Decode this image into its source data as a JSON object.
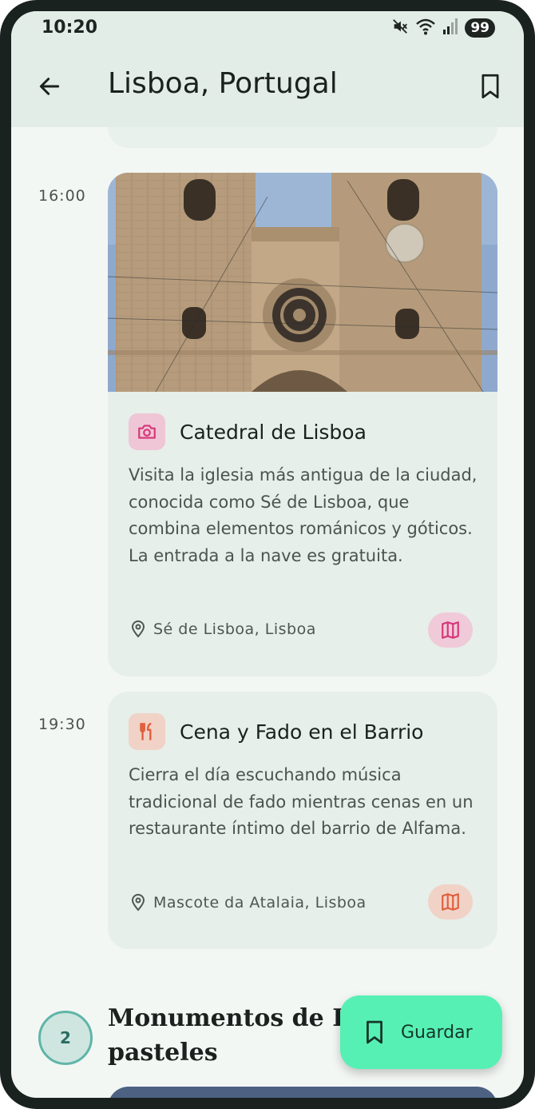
{
  "status_bar": {
    "time": "10:20",
    "battery": "99"
  },
  "app_bar": {
    "title": "Lisboa, Portugal"
  },
  "itinerary": [
    {
      "time": "16:00",
      "title": "Catedral de Lisboa",
      "category_icon": "camera-icon",
      "description": "Visita la iglesia más antigua de la ciudad, conocida como Sé de Lisboa, que combina elementos románicos y góticos. La entrada a la nave es gratuita.",
      "location": "Sé de Lisboa, Lisboa",
      "accent": "#d6367a"
    },
    {
      "time": "19:30",
      "title": "Cena y Fado en el Barrio",
      "category_icon": "restaurant-icon",
      "description": "Cierra el día escuchando música tradicional de fado mientras cenas en un restaurante íntimo del barrio de Alfama.",
      "location": "Mascote da Atalaia, Lisboa",
      "accent": "#e0603e"
    }
  ],
  "next_day": {
    "number": "2",
    "title_line1": "Monumentos de B",
    "title_line2": "pasteles"
  },
  "fab": {
    "label": "Guardar"
  },
  "colors": {
    "fab": "#57f0b4",
    "card": "#e6efe9",
    "appbar": "#e2ede7"
  }
}
